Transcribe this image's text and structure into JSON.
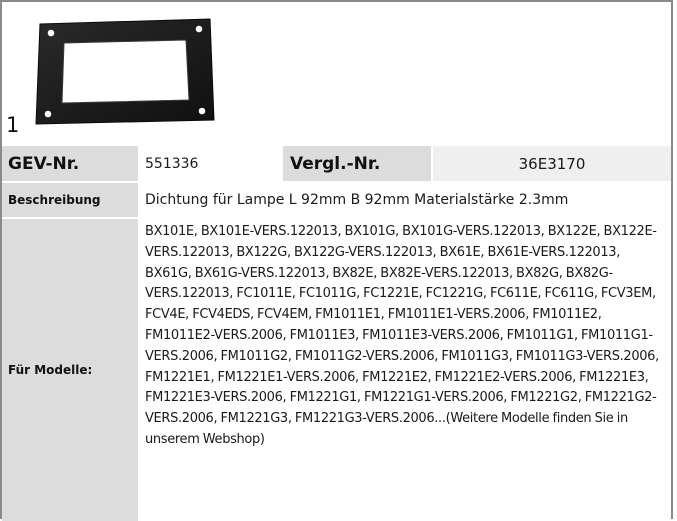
{
  "image": {
    "number": "1",
    "icon": "gasket-image"
  },
  "gev": {
    "label": "GEV-Nr.",
    "value": "551336"
  },
  "vergl": {
    "label": "Vergl.-Nr.",
    "value": "36E3170"
  },
  "beschreibung": {
    "label": "Beschreibung",
    "value": "Dichtung  für Lampe L 92mm B 92mm Materialstärke 2.3mm"
  },
  "modelle": {
    "label": "Für Modelle:",
    "value": "BX101E, BX101E-VERS.122013, BX101G, BX101G-VERS.122013, BX122E, BX122E-VERS.122013, BX122G, BX122G-VERS.122013, BX61E, BX61E-VERS.122013, BX61G, BX61G-VERS.122013, BX82E, BX82E-VERS.122013, BX82G, BX82G-VERS.122013, FC1011E, FC1011G, FC1221E, FC1221G, FC611E, FC611G, FCV3EM, FCV4E, FCV4EDS, FCV4EM, FM1011E1, FM1011E1-VERS.2006, FM1011E2, FM1011E2-VERS.2006, FM1011E3, FM1011E3-VERS.2006, FM1011G1, FM1011G1-VERS.2006, FM1011G2, FM1011G2-VERS.2006, FM1011G3, FM1011G3-VERS.2006, FM1221E1, FM1221E1-VERS.2006, FM1221E2, FM1221E2-VERS.2006, FM1221E3, FM1221E3-VERS.2006, FM1221G1, FM1221G1-VERS.2006, FM1221G2, FM1221G2-VERS.2006, FM1221G3, FM1221G3-VERS.2006...(Weitere Modelle finden Sie in unserem Webshop)"
  },
  "colors": {
    "label_bg": "#dcdcdc",
    "value_alt_bg": "#efefef",
    "border": "#8a8a8a",
    "gasket": "#1c1c1c"
  }
}
